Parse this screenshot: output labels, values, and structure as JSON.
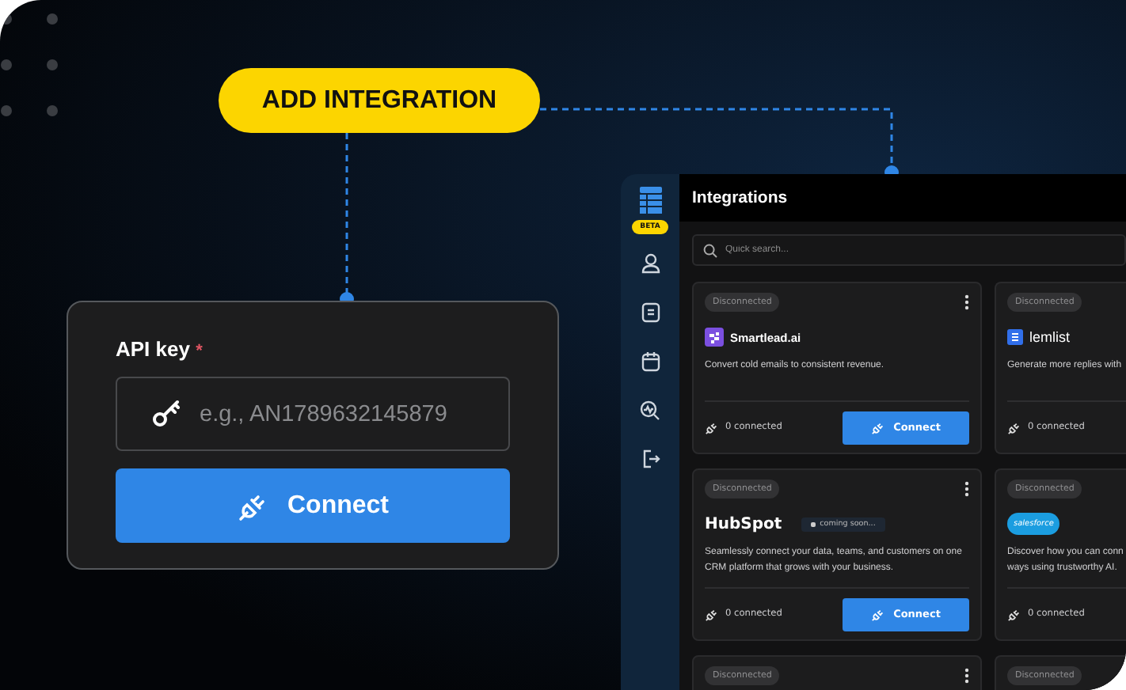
{
  "badge": {
    "label": "ADD INTEGRATION"
  },
  "api_form": {
    "label": "API key",
    "required_mark": "*",
    "placeholder": "e.g., AN1789632145879",
    "button": "Connect"
  },
  "app": {
    "beta_badge": "BETA",
    "title": "Integrations",
    "search": {
      "placeholder": "Quick search..."
    },
    "cards": [
      {
        "kind": "smartlead",
        "status": "Disconnected",
        "menu": true,
        "name": "Smartlead.ai",
        "description": "Convert cold emails to consistent revenue.",
        "connected": "0 connected",
        "button": "Connect"
      },
      {
        "kind": "lemlist",
        "status": "Disconnected",
        "menu": false,
        "name": "lemlist",
        "description": "Generate more replies with",
        "connected": "0 connected"
      },
      {
        "kind": "hubspot",
        "status": "Disconnected",
        "menu": true,
        "name": "HubSpot",
        "tag": "coming soon...",
        "description": "Seamlessly connect your data, teams, and customers on one CRM platform that grows with your business.",
        "connected": "0 connected",
        "button": "Connect"
      },
      {
        "kind": "salesforce",
        "status": "Disconnected",
        "menu": false,
        "name": "salesforce",
        "description": "Discover how you can conn ways using trustworthy AI.",
        "connected": "0 connected"
      },
      {
        "status": "Disconnected",
        "menu": true
      },
      {
        "status": "Disconnected",
        "menu": false
      }
    ]
  }
}
